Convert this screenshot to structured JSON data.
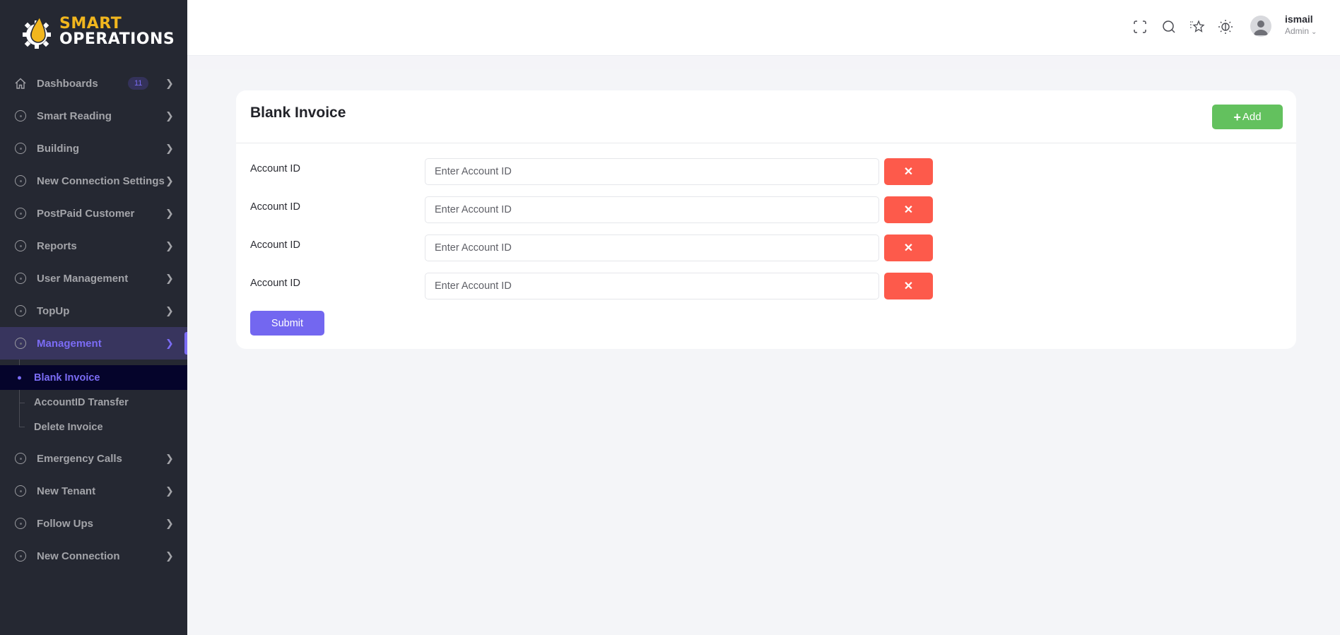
{
  "brand": {
    "line1": "SMART",
    "line2": "OPERATIONS",
    "colors": {
      "accent": "#f1b61e",
      "sidebar_bg": "#252832",
      "primary": "#7367f0",
      "success": "#63c15e",
      "danger": "#fd5a4b"
    }
  },
  "sidebar": {
    "items": [
      {
        "label": "Dashboards",
        "icon": "home-icon",
        "badge": "11"
      },
      {
        "label": "Smart Reading",
        "icon": "circle-icon"
      },
      {
        "label": "Building",
        "icon": "circle-icon"
      },
      {
        "label": "New Connection Settings",
        "icon": "circle-icon"
      },
      {
        "label": "PostPaid Customer",
        "icon": "circle-icon"
      },
      {
        "label": "Reports",
        "icon": "circle-icon"
      },
      {
        "label": "User Management",
        "icon": "circle-icon"
      },
      {
        "label": "TopUp",
        "icon": "circle-icon"
      },
      {
        "label": "Management",
        "icon": "circle-icon",
        "active": true,
        "children": [
          {
            "label": "Blank Invoice",
            "active": true
          },
          {
            "label": "AccountID Transfer"
          },
          {
            "label": "Delete Invoice"
          }
        ]
      },
      {
        "label": "Emergency Calls",
        "icon": "circle-icon"
      },
      {
        "label": "New Tenant",
        "icon": "circle-icon"
      },
      {
        "label": "Follow Ups",
        "icon": "circle-icon"
      },
      {
        "label": "New Connection",
        "icon": "circle-icon"
      }
    ]
  },
  "header": {
    "icons": [
      "fullscreen-icon",
      "search-icon",
      "favorites-icon",
      "theme-toggle-icon"
    ],
    "user": {
      "name": "ismail",
      "role": "Admin"
    }
  },
  "main": {
    "title": "Blank Invoice",
    "add_label": "Add",
    "rows": [
      {
        "label": "Account ID",
        "placeholder": "Enter Account ID",
        "value": ""
      },
      {
        "label": "Account ID",
        "placeholder": "Enter Account ID",
        "value": ""
      },
      {
        "label": "Account ID",
        "placeholder": "Enter Account ID",
        "value": ""
      },
      {
        "label": "Account ID",
        "placeholder": "Enter Account ID",
        "value": ""
      }
    ],
    "remove_label": "✕",
    "submit_label": "Submit"
  }
}
